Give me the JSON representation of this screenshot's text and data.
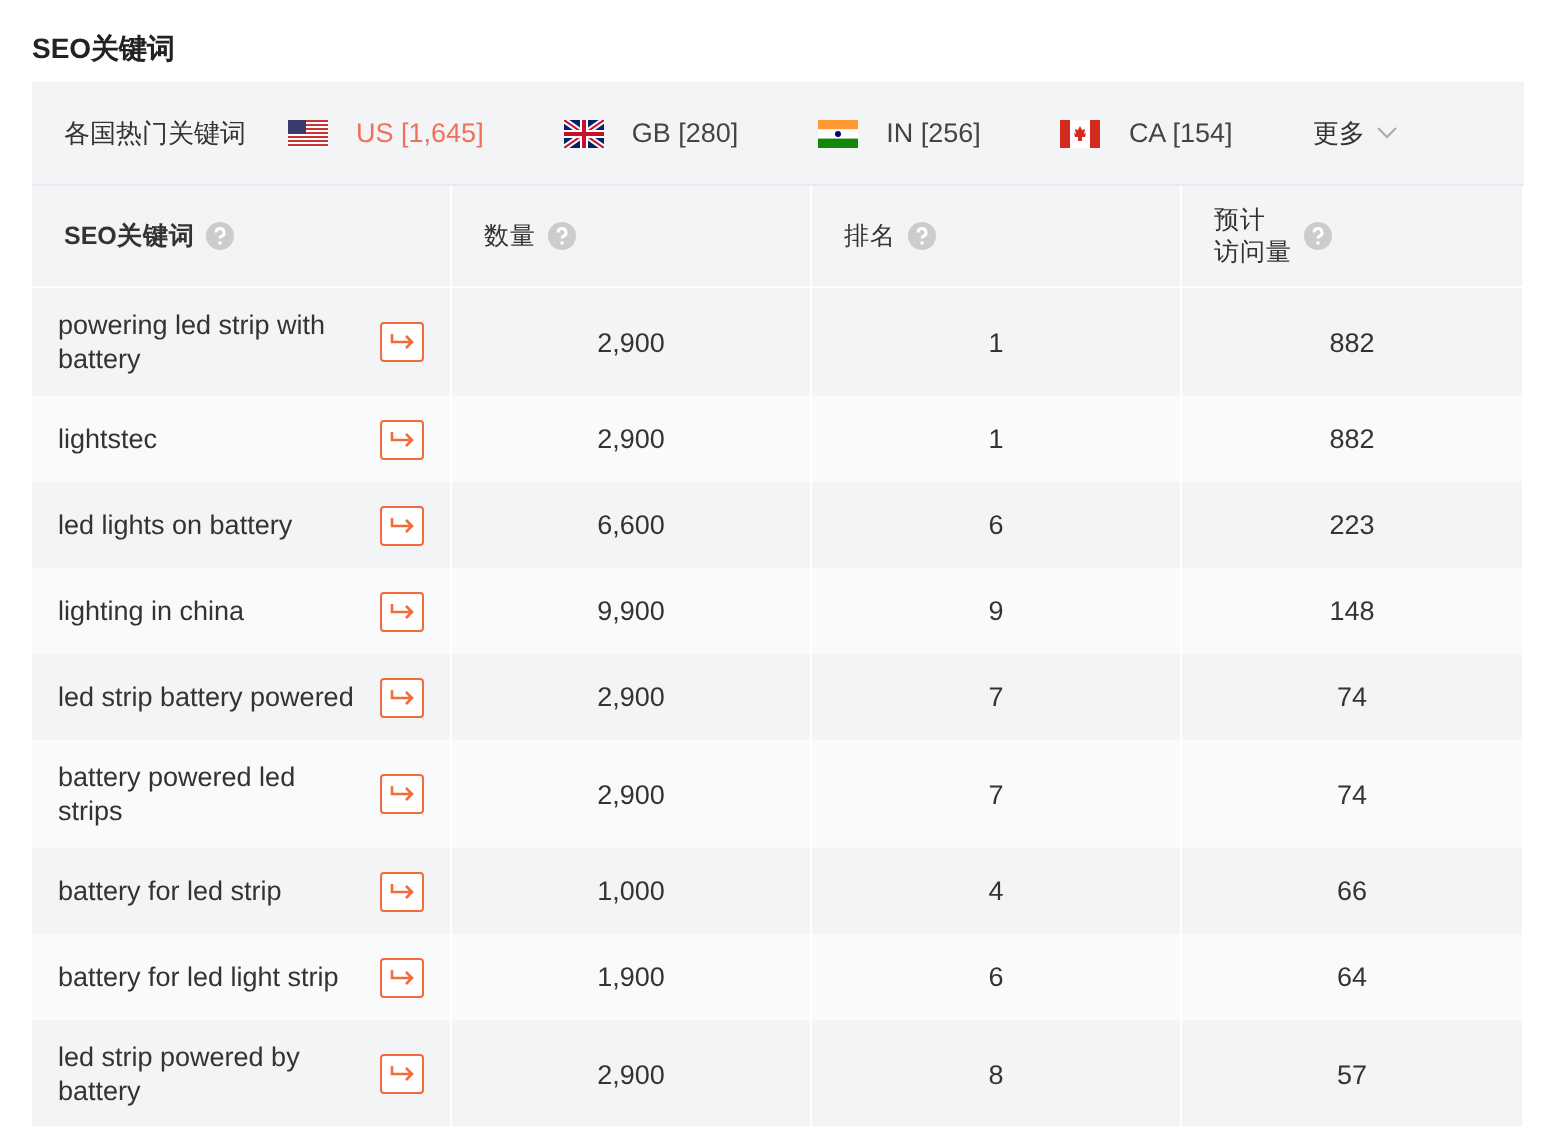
{
  "title": "SEO关键词",
  "countries_label": "各国热门关键词",
  "countries": [
    {
      "code": "US",
      "count": "[1,645]",
      "kind": "us",
      "selected": true
    },
    {
      "code": "GB",
      "count": "[280]",
      "kind": "gb",
      "selected": false
    },
    {
      "code": "IN",
      "count": "[256]",
      "kind": "in",
      "selected": false
    },
    {
      "code": "CA",
      "count": "[154]",
      "kind": "ca",
      "selected": false
    }
  ],
  "more": "更多",
  "columns": [
    {
      "lines": [
        "SEO关键词"
      ]
    },
    {
      "lines": [
        "数量"
      ]
    },
    {
      "lines": [
        "排名"
      ]
    },
    {
      "lines": [
        "预计",
        "访问量"
      ]
    }
  ],
  "rows": [
    {
      "keyword": "powering led strip with battery",
      "volume": "2,900",
      "rank": "1",
      "visits": "882"
    },
    {
      "keyword": "lightstec",
      "volume": "2,900",
      "rank": "1",
      "visits": "882"
    },
    {
      "keyword": "led lights on battery",
      "volume": "6,600",
      "rank": "6",
      "visits": "223"
    },
    {
      "keyword": "lighting in china",
      "volume": "9,900",
      "rank": "9",
      "visits": "148"
    },
    {
      "keyword": "led strip battery powered",
      "volume": "2,900",
      "rank": "7",
      "visits": "74"
    },
    {
      "keyword": "battery powered led strips",
      "volume": "2,900",
      "rank": "7",
      "visits": "74"
    },
    {
      "keyword": "battery for led strip",
      "volume": "1,000",
      "rank": "4",
      "visits": "66"
    },
    {
      "keyword": "battery for led light strip",
      "volume": "1,900",
      "rank": "6",
      "visits": "64"
    },
    {
      "keyword": "led strip powered by battery",
      "volume": "2,900",
      "rank": "8",
      "visits": "57"
    }
  ]
}
